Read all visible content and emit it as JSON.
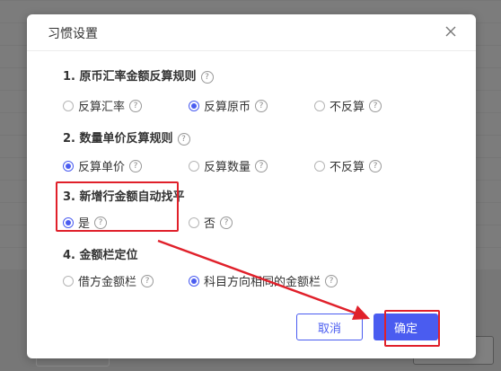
{
  "dialog": {
    "title": "习惯设置"
  },
  "sections": [
    {
      "title": "1. 原币汇率金额反算规则",
      "options": [
        {
          "label": "反算汇率",
          "checked": false
        },
        {
          "label": "反算原币",
          "checked": true
        },
        {
          "label": "不反算",
          "checked": false
        }
      ]
    },
    {
      "title": "2. 数量单价反算规则",
      "options": [
        {
          "label": "反算单价",
          "checked": true
        },
        {
          "label": "反算数量",
          "checked": false
        },
        {
          "label": "不反算",
          "checked": false
        }
      ]
    },
    {
      "title": "3. 新增行金额自动找平",
      "options": [
        {
          "label": "是",
          "checked": true
        },
        {
          "label": "否",
          "checked": false
        }
      ]
    },
    {
      "title": "4. 金额栏定位",
      "options": [
        {
          "label": "借方金额栏",
          "checked": false
        },
        {
          "label": "科目方向相同的金额栏",
          "checked": true
        }
      ]
    }
  ],
  "buttons": {
    "cancel": "取消",
    "ok": "确定"
  },
  "help_glyph": "?",
  "colors": {
    "accent": "#4a5cf0",
    "annotation_red": "#e0202a"
  }
}
